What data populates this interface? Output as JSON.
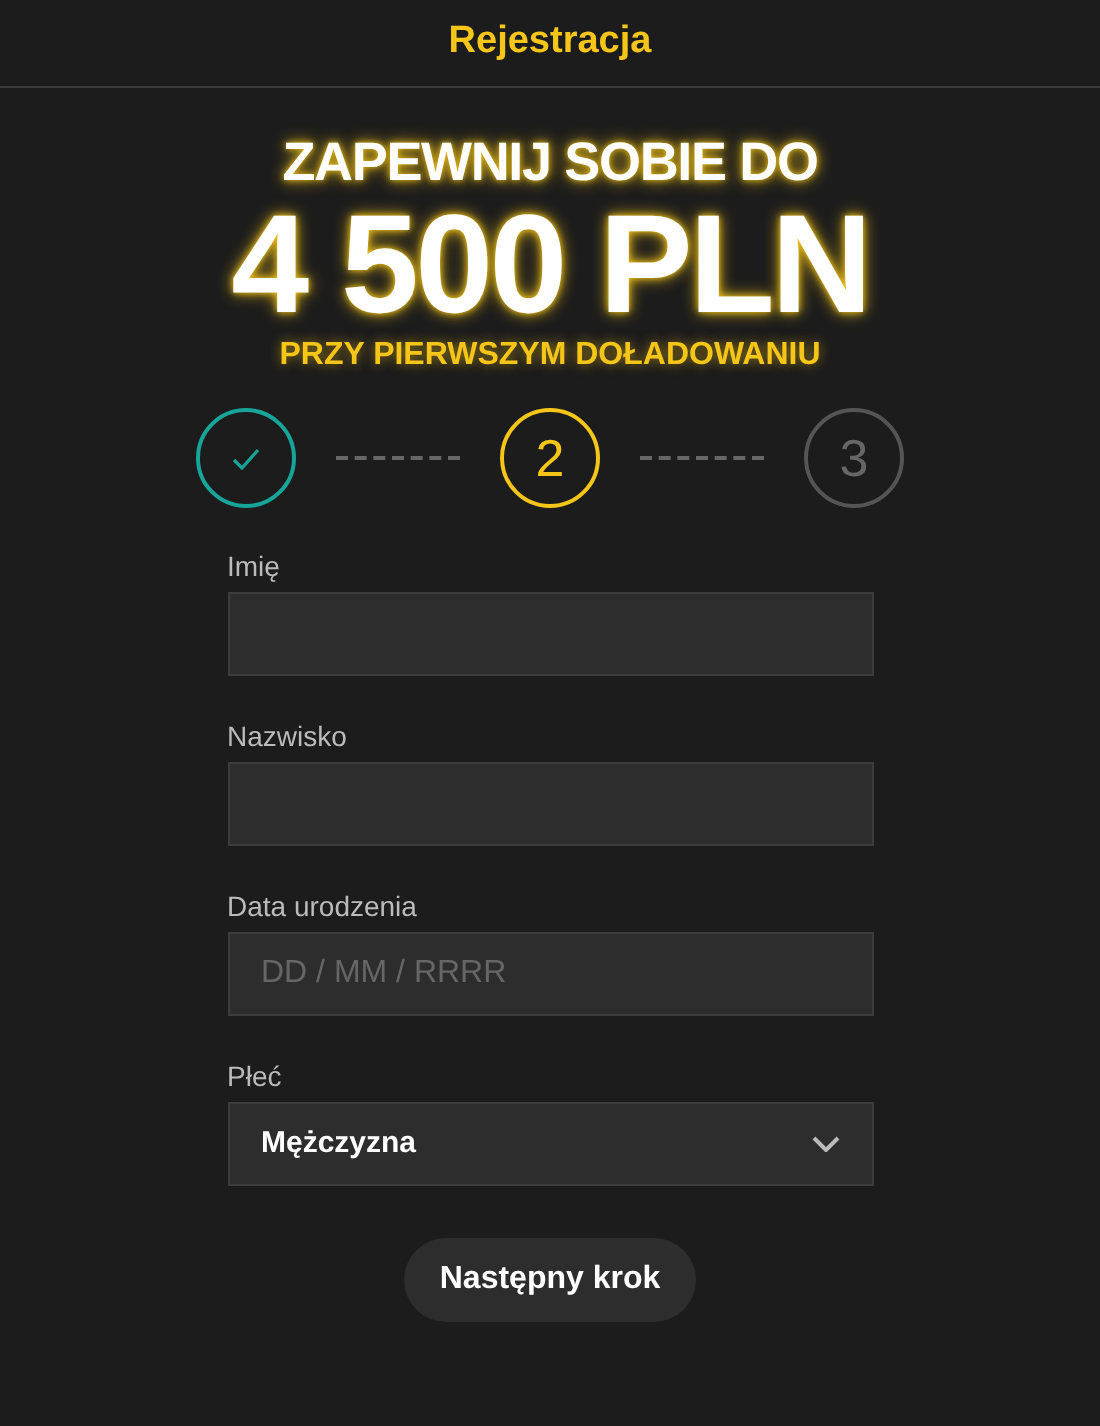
{
  "header": {
    "title": "Rejestracja"
  },
  "promo": {
    "line_1": "ZAPEWNIJ SOBIE DO",
    "amount": "4 500 PLN",
    "line_3": "PRZY PIERWSZYM DOŁADOWANIU"
  },
  "steps": [
    {
      "completed": true,
      "selected": false
    },
    {
      "label": "2",
      "completed": false,
      "selected": true
    },
    {
      "label": "3",
      "completed": false,
      "selected": false
    }
  ],
  "fields": [
    {
      "kind": "text",
      "label": "Imię"
    },
    {
      "kind": "text",
      "label": "Nazwisko"
    },
    {
      "kind": "text",
      "label": "Data urodzenia",
      "placeholder": "DD / MM / RRRR"
    },
    {
      "kind": "select",
      "label": "Płeć",
      "value": "Mężczyzna"
    }
  ],
  "button": "Następny krok"
}
